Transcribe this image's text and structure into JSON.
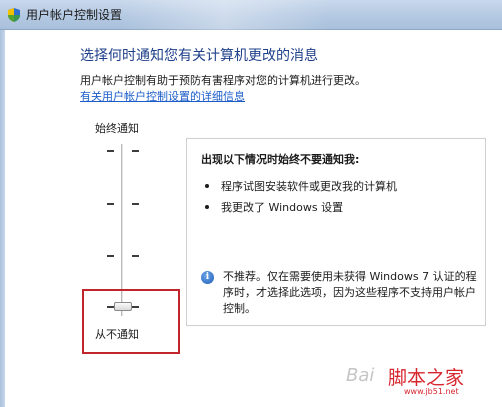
{
  "window": {
    "title": "用户帐户控制设置"
  },
  "main": {
    "heading": "选择何时通知您有关计算机更改的消息",
    "description": "用户帐户控制有助于预防有害程序对您的计算机进行更改。",
    "link": "有关用户帐户控制设置的详细信息"
  },
  "slider": {
    "top_label": "始终通知",
    "bottom_label": "从不通知",
    "levels": 4,
    "selected_level": 0
  },
  "panel": {
    "title": "出现以下情况时始终不要通知我:",
    "bullets": [
      "程序试图安装软件或更改我的计算机",
      "我更改了 Windows 设置"
    ],
    "note_lines": [
      "不推荐。仅在需要使用未获得 Windows 7 认证的程",
      "序时，才选择此选项，因为这些程序不支持用户帐户",
      "控制。"
    ]
  },
  "watermark": {
    "baidu": "Bai",
    "site": "脚本之家",
    "url": "www.jb51.net"
  },
  "colors": {
    "heading": "#1e3f8a",
    "link": "#1a5cc8",
    "highlight": "#c0262c",
    "watermark": "#d8262f"
  }
}
